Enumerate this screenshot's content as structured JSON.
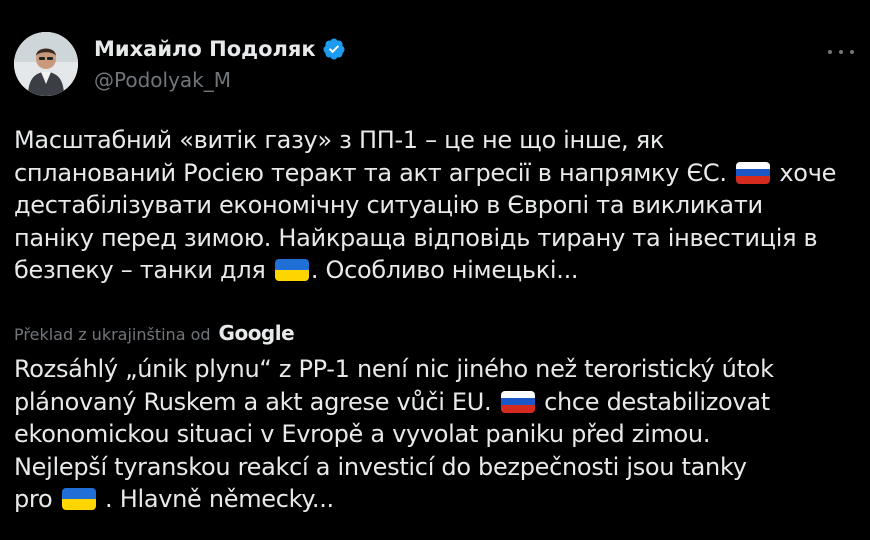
{
  "author": {
    "display_name": "Михайло Подоляк",
    "handle": "@Podolyak_M",
    "verified": true
  },
  "icons": {
    "verified": "verified-badge-icon",
    "more": "more-options-icon",
    "flag_ru": "russia-flag-emoji",
    "flag_ua": "ukraine-flag-emoji"
  },
  "colors": {
    "background": "#000000",
    "text": "#e7e9ea",
    "secondary_text": "#71767b",
    "verified_badge": "#1d9bf0"
  },
  "tweet": {
    "original_lines": [
      {
        "text": "Масштабний «витік газу» з ПП-1 – це не що інше, як"
      },
      {
        "before": "спланований Росією теракт та акт агресії в напрямку ЄС.",
        "after": "хоче"
      },
      {
        "text": "дестабілізувати економічну ситуацію в Європі та викликати"
      },
      {
        "text": "паніку перед зимою. Найкраща відповідь тирану та інвестиція в"
      },
      {
        "before": "безпеку – танки для",
        "after": ". Особливо німецькі..."
      }
    ],
    "translation_note": "Překlad z ukrajinština od",
    "translation_provider": "Google",
    "translated_lines": [
      {
        "text": "Rozsáhlý „únik plynu“ z PP-1 není nic jiného než teroristický útok"
      },
      {
        "before": "plánovaný Ruskem a akt agrese vůči EU.",
        "after": "chce destabilizovat"
      },
      {
        "text": "ekonomickou situaci v Evropě a vyvolat paniku před zimou."
      },
      {
        "text": "Nejlepší tyranskou reakcí a investicí do bezpečnosti jsou tanky"
      },
      {
        "before": "pro",
        "after": ". Hlavně německy..."
      }
    ]
  }
}
